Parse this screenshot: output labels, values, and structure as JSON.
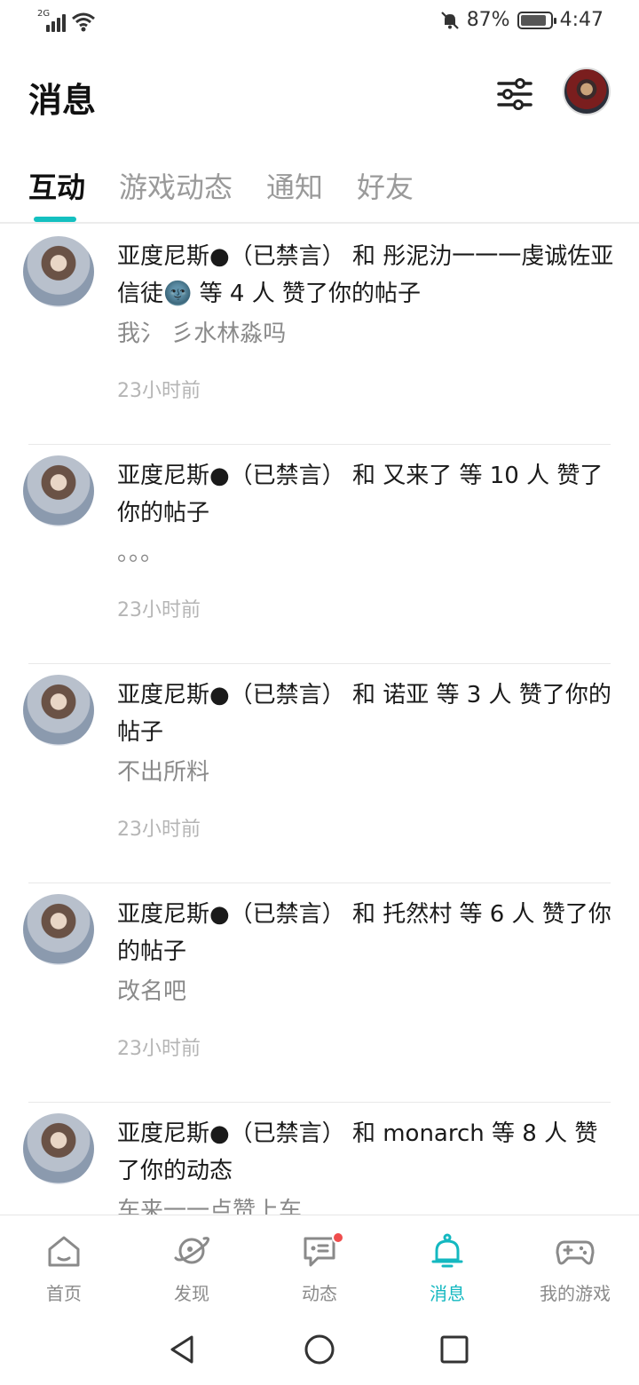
{
  "status_bar": {
    "network_type": "2G",
    "battery_percent": "87%",
    "battery_level": 0.87,
    "time": "4:47"
  },
  "header": {
    "title": "消息"
  },
  "tabs": [
    {
      "label": "互动",
      "active": true
    },
    {
      "label": "游戏动态",
      "active": false
    },
    {
      "label": "通知",
      "active": false
    },
    {
      "label": "好友",
      "active": false
    }
  ],
  "messages": [
    {
      "title": "亚度尼斯●（已禁言） 和 彤泥氻一一一虔诚佐亚信徒🌚 等 4 人 赞了你的帖子",
      "content": "我氵 彡水林淼吗",
      "time": "23小时前"
    },
    {
      "title": "亚度尼斯●（已禁言） 和 又来了 等 10 人 赞了你的帖子",
      "content": "。。。",
      "time": "23小时前"
    },
    {
      "title": "亚度尼斯●（已禁言） 和 诺亚 等 3 人 赞了你的帖子",
      "content": "不出所料",
      "time": "23小时前"
    },
    {
      "title": "亚度尼斯●（已禁言） 和 托然村 等 6 人 赞了你的帖子",
      "content": "改名吧",
      "time": "23小时前"
    },
    {
      "title": "亚度尼斯●（已禁言） 和 monarch 等 8 人 赞了你的动态",
      "content": "车来一一点赞上车",
      "time": ""
    }
  ],
  "bottom_nav": [
    {
      "label": "首页",
      "icon": "home-icon",
      "active": false
    },
    {
      "label": "发现",
      "icon": "planet-icon",
      "active": false
    },
    {
      "label": "动态",
      "icon": "chat-icon",
      "active": false,
      "badge": true
    },
    {
      "label": "消息",
      "icon": "bell-icon",
      "active": true
    },
    {
      "label": "我的游戏",
      "icon": "gamepad-icon",
      "active": false
    }
  ],
  "colors": {
    "accent": "#14c0c0",
    "badge": "#ef4d4d"
  }
}
